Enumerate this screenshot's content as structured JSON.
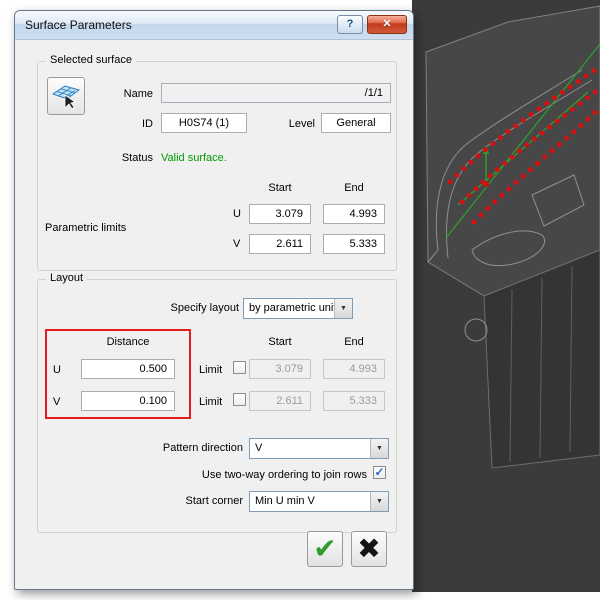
{
  "window": {
    "title": "Surface Parameters"
  },
  "icons": {
    "help": "?",
    "close": "✕",
    "dropdown": "▼",
    "checkbox_check": "✓",
    "ok_check": "✔",
    "cancel_x": "✖"
  },
  "colors": {
    "status_valid": "#009b00",
    "highlight_box": "#e31e1e",
    "ok_green": "#2e9e2e",
    "titlebar_blue": "#cfdff0",
    "viewport_bg": "#3b3b3b",
    "point_red": "#d01212",
    "path_green": "#2f9e2f"
  },
  "selected_surface": {
    "group_label": "Selected surface",
    "name_label": "Name",
    "name_value": "/1/1",
    "id_label": "ID",
    "id_value": "H0S74 (1)",
    "level_label": "Level",
    "level_value": "General",
    "status_label": "Status",
    "status_value": "Valid surface.",
    "col_start": "Start",
    "col_end": "End",
    "parametric_limits_label": "Parametric limits",
    "u_label": "U",
    "v_label": "V",
    "u_start": "3.079",
    "u_end": "4.993",
    "v_start": "2.611",
    "v_end": "5.333"
  },
  "layout_group": {
    "group_label": "Layout",
    "specify_label": "Specify layout",
    "specify_value": "by parametric units",
    "distance_header": "Distance",
    "col_start": "Start",
    "col_end": "End",
    "u_label": "U",
    "v_label": "V",
    "u_distance": "0.500",
    "v_distance": "0.100",
    "limit_label": "Limit",
    "u_start": "3.079",
    "u_end": "4.993",
    "v_start": "2.611",
    "v_end": "5.333",
    "pattern_label": "Pattern direction",
    "pattern_value": "V",
    "two_way_label": "Use two-way ordering to join rows",
    "two_way_checked": true,
    "start_corner_label": "Start corner",
    "start_corner_value": "Min U min V"
  }
}
